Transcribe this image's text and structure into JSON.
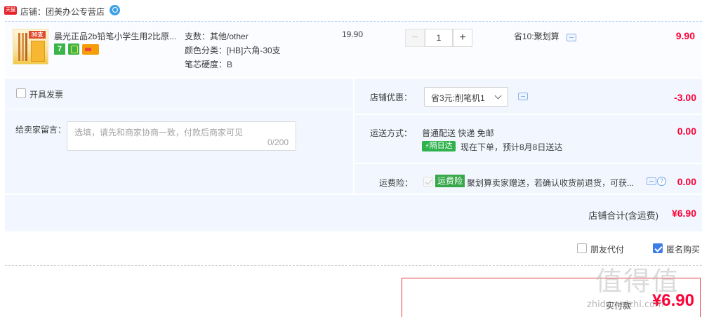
{
  "shop": {
    "badge": "天猫",
    "label": "店铺：团美办公专营店"
  },
  "item": {
    "thumb_tag": "30支",
    "title": "晨光正品2b铅笔小学生用2比原...",
    "specs": [
      "支数：其他/other",
      "颜色分类：[HB]六角-30支",
      "笔芯硬度：B"
    ],
    "unit_price": "19.90",
    "quantity": "1",
    "minus": "−",
    "plus": "+",
    "promo": "省10:聚划算",
    "total": "9.90"
  },
  "options": {
    "invoice_label": "开具发票",
    "message_label": "给卖家留言：",
    "message_placeholder": "选填，请先和商家协商一致，付款后商家可见",
    "message_count": "0/200",
    "coupon_label": "店铺优惠：",
    "coupon_selected": "省3元:削笔机1",
    "coupon_amount": "-3.00",
    "shipping_label": "运送方式：",
    "shipping_method": "普通配送 快递 免邮",
    "shipping_tag": "隔日达",
    "shipping_eta": "现在下单，预计8月8日送达",
    "shipping_fee": "0.00",
    "insurance_label": "运费险：",
    "insurance_tag": "运费险",
    "insurance_text": "聚划算卖家赠送，若确认收货前退货，可获...",
    "insurance_fee": "0.00",
    "help_glyph": "?",
    "shop_total_label": "店铺合计(含运费)",
    "shop_total": "¥6.90"
  },
  "footer": {
    "friend_pay": "朋友代付",
    "anonymous": "匿名购买",
    "pay_label": "实付款",
    "pay_amount": "¥6.90"
  },
  "watermark": "值得值",
  "watermark_url": "zhidemaizhi.com",
  "colors": {
    "price_red": "#ff0036",
    "panel_bg": "#f2f7ff",
    "checkbox_blue": "#3d7de8",
    "badge_green": "#2fb24d"
  }
}
